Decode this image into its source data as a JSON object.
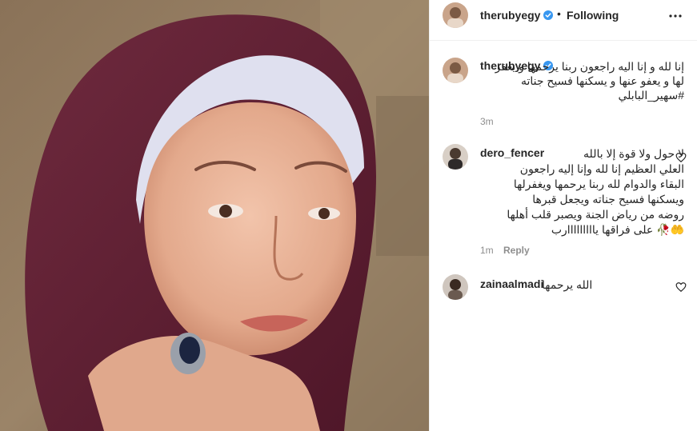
{
  "post": {
    "author": "therubyegy",
    "follow_status": "Following",
    "separator": "•",
    "caption": "إنا لله و إنا اليه راجعون ربنا يرحمها و يغفر لها و يعفو عنها و يسكنها فسيح جناته #سهير_البابلي",
    "caption_time": "3m"
  },
  "comments": [
    {
      "user": "dero_fencer",
      "text": "لا حول ولا قوة إلا بالله\nالعلي العظيم إنا لله وإنا إليه راجعون\nالبقاء والدوام لله ربنا يرحمها ويغفرلها\nويسكنها فسيح جناته ويجعل قبرها\nروضه من رياض الجنة ويصبر قلب أهلها\n🤲🥀 على فراقها يااااااااارب",
      "time": "1m",
      "reply": "Reply"
    },
    {
      "user": "zainaalmadi",
      "text": "الله يرحمها"
    }
  ],
  "icons": {
    "verified": "verified-badge-icon",
    "more": "more-options-icon",
    "like": "heart-icon"
  },
  "colors": {
    "verified": "#3897f0",
    "secondary_text": "#8e8e8e",
    "primary_text": "#262626",
    "border": "#efefef"
  }
}
